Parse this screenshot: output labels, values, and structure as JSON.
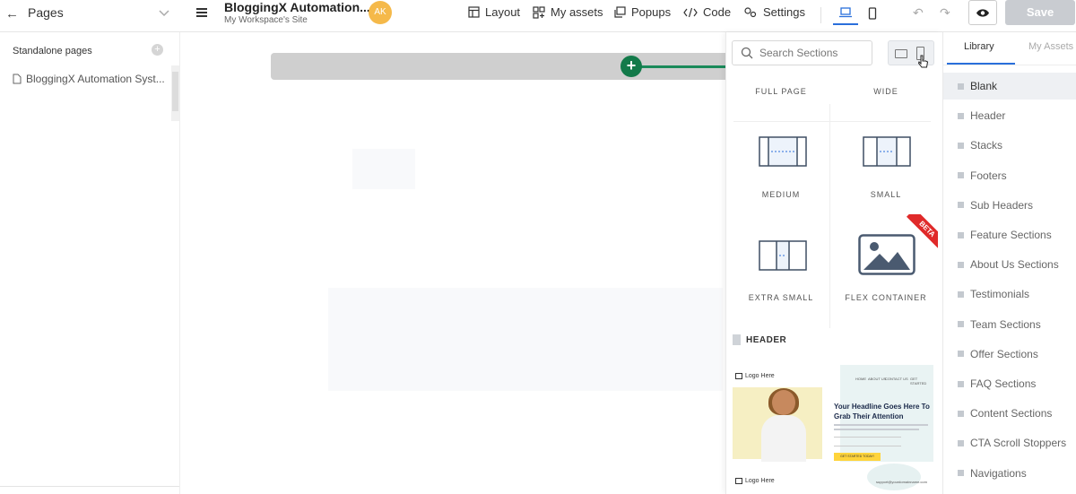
{
  "topbar": {
    "pages_label": "Pages",
    "site_title": "BloggingX Automation...",
    "site_subtitle": "My Workspace's Site",
    "avatar_initials": "AK",
    "nav": [
      {
        "label": "Layout",
        "icon": "layout-icon"
      },
      {
        "label": "My assets",
        "icon": "assets-icon"
      },
      {
        "label": "Popups",
        "icon": "popups-icon"
      },
      {
        "label": "Code",
        "icon": "code-icon"
      },
      {
        "label": "Settings",
        "icon": "settings-icon"
      }
    ],
    "save_label": "Save"
  },
  "leftbar": {
    "heading": "Standalone pages",
    "add_symbol": "+",
    "pages": [
      "BloggingX Automation Syst..."
    ]
  },
  "panel": {
    "search_placeholder": "Search Sections",
    "layouts": [
      {
        "label": "FULL PAGE"
      },
      {
        "label": "WIDE"
      },
      {
        "label": "MEDIUM"
      },
      {
        "label": "SMALL"
      },
      {
        "label": "EXTRA SMALL"
      },
      {
        "label": "FLEX CONTAINER",
        "badge": "BETA"
      }
    ],
    "header_section_label": "HEADER",
    "header_thumbnail": {
      "logo": "Logo Here",
      "nav": [
        "HOME",
        "ABOUT US",
        "CONTACT US",
        "GET STARTED"
      ],
      "headline": "Your Headline Goes Here To Grab Their Attention",
      "cta": "GET STARTED TODAY!",
      "footer_logo": "Logo Here",
      "footer_text": "support@yourdomainname.com"
    }
  },
  "library": {
    "tabs": [
      "Library",
      "My Assets"
    ],
    "active_tab": "Library",
    "items": [
      "Blank",
      "Header",
      "Stacks",
      "Footers",
      "Sub Headers",
      "Feature Sections",
      "About Us Sections",
      "Testimonials",
      "Team Sections",
      "Offer Sections",
      "FAQ Sections",
      "Content Sections",
      "CTA Scroll Stoppers",
      "Navigations"
    ],
    "selected": "Blank"
  },
  "colors": {
    "accent": "#2a6fdb",
    "add_button": "#137a4a",
    "avatar": "#f5b94a",
    "save_disabled": "#c9ccd1",
    "beta_badge": "#e02a2a"
  }
}
